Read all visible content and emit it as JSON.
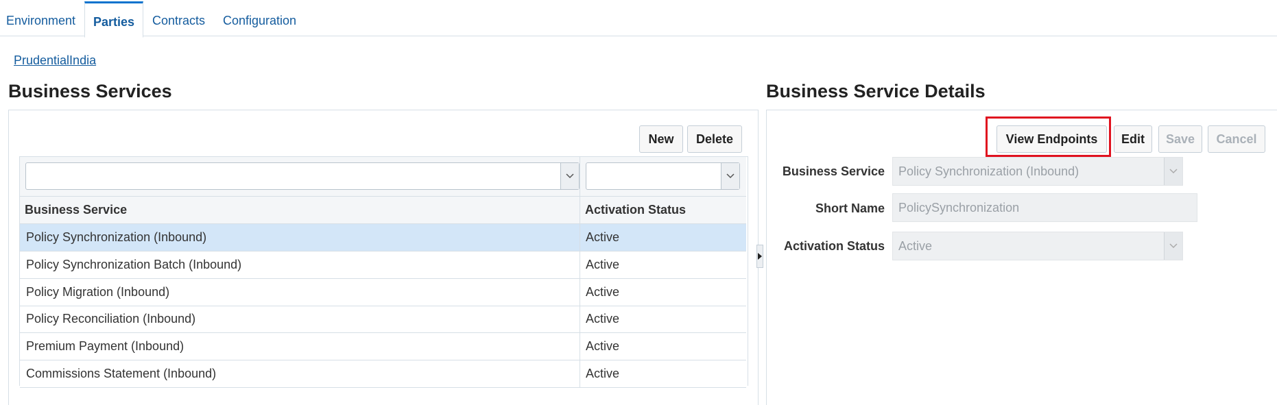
{
  "tabs": [
    {
      "label": "Environment"
    },
    {
      "label": "Parties"
    },
    {
      "label": "Contracts"
    },
    {
      "label": "Configuration"
    }
  ],
  "breadcrumb": {
    "label": "PrudentialIndia"
  },
  "left": {
    "title": "Business Services",
    "new_label": "New",
    "delete_label": "Delete",
    "columns": [
      "Business Service",
      "Activation Status"
    ],
    "rows": [
      {
        "service": "Policy Synchronization (Inbound)",
        "status": "Active"
      },
      {
        "service": "Policy Synchronization Batch (Inbound)",
        "status": "Active"
      },
      {
        "service": "Policy Migration (Inbound)",
        "status": "Active"
      },
      {
        "service": "Policy Reconciliation (Inbound)",
        "status": "Active"
      },
      {
        "service": "Premium Payment (Inbound)",
        "status": "Active"
      },
      {
        "service": "Commissions Statement (Inbound)",
        "status": "Active"
      }
    ]
  },
  "right": {
    "title": "Business Service Details",
    "view_endpoints_label": "View Endpoints",
    "edit_label": "Edit",
    "save_label": "Save",
    "cancel_label": "Cancel",
    "fields": {
      "business_service_label": "Business Service",
      "business_service_value": "Policy Synchronization (Inbound)",
      "short_name_label": "Short Name",
      "short_name_value": "PolicySynchronization",
      "activation_status_label": "Activation Status",
      "activation_status_value": "Active"
    }
  },
  "colors": {
    "accent": "#0572ce",
    "highlight": "#e0121f",
    "selected_row": "#d3e6f8"
  }
}
